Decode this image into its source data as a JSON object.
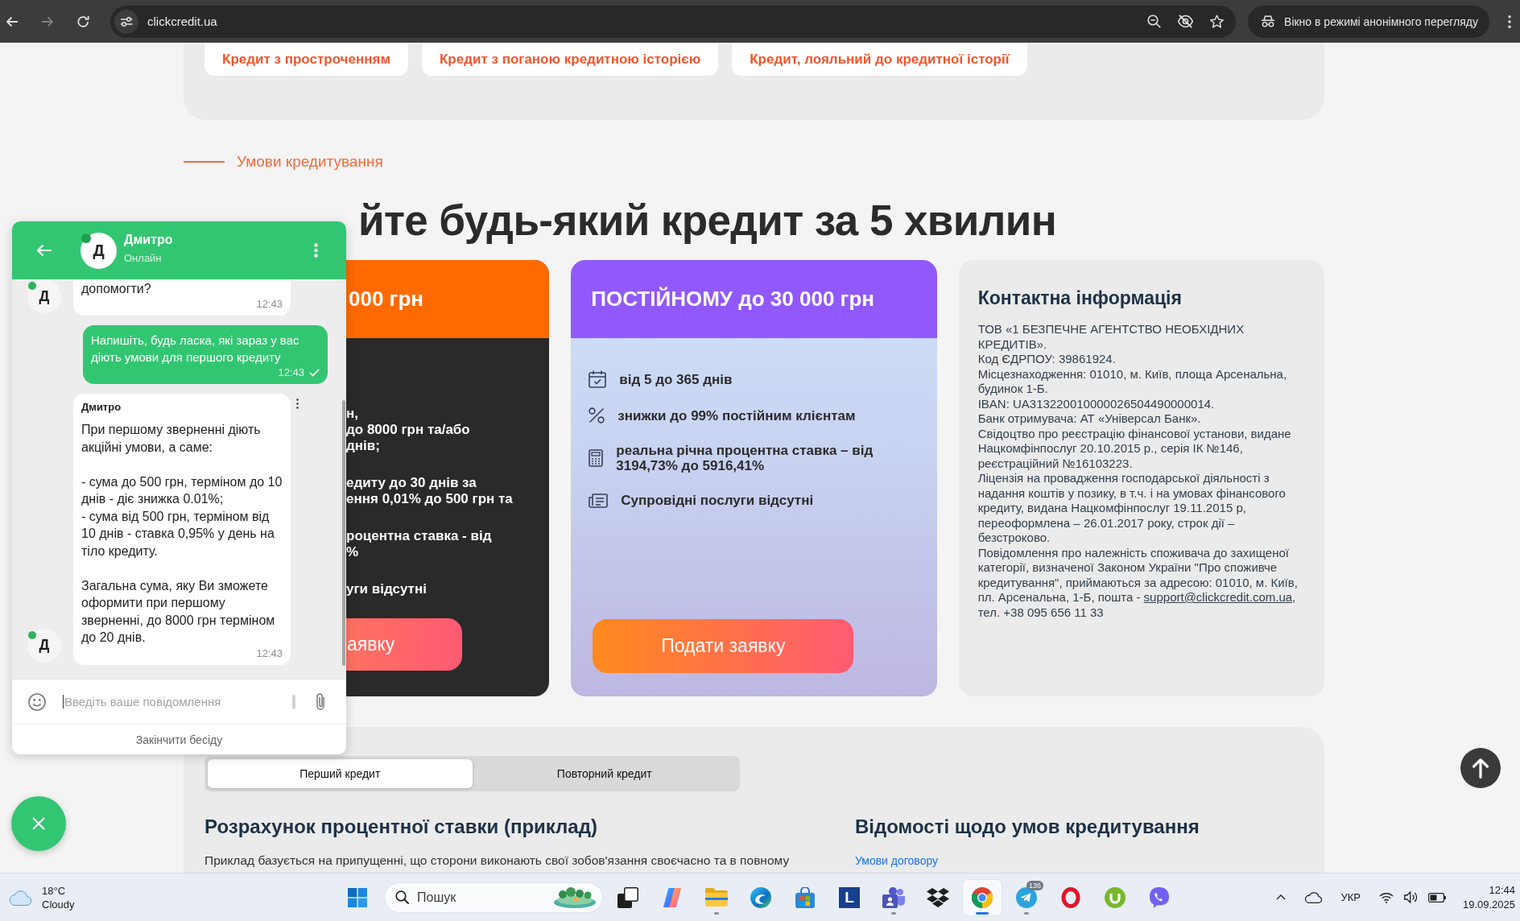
{
  "browser": {
    "url": "clickcredit.ua",
    "incognito_label": "Вікно в режимі анонімного перегляду",
    "back_disabled": false,
    "forward_disabled": true
  },
  "top_links": [
    "Кредит з простроченням",
    "Кредит з поганою кредитною історією",
    "Кредит, лояльний до кредитної історії"
  ],
  "section_label": "Умови кредитування",
  "heading": "йте будь-який кредит за 5 хвилин",
  "offers": [
    {
      "kind": "newcomer",
      "title": "000 грн",
      "items": [
        {
          "lines": [
            "н,",
            "до 8000 грн та/або",
            "днів;"
          ]
        },
        {
          "lines": [
            "едиту до 30 днів за",
            "ення 0,01% до 500 грн та"
          ]
        },
        {
          "lines": [
            "роцентна ставка - від",
            "%"
          ]
        },
        {
          "lines": [
            "уги відсутні"
          ]
        }
      ],
      "button": "аявку"
    },
    {
      "kind": "regular",
      "title": "ПОСТІЙНОМУ до 30 000 грн",
      "items": [
        {
          "kind": "term",
          "text": "від 5 до 365 днів"
        },
        {
          "kind": "discount",
          "text": "знижки до 99% постійним клієнтам"
        },
        {
          "kind": "rate",
          "text": "реальна річна процентна ставка – від 3194,73% до 5916,41%"
        },
        {
          "kind": "services",
          "text": "Супровідні послуги відсутні"
        }
      ],
      "button": "Подати заявку"
    }
  ],
  "contact": {
    "title": "Контактна інформація",
    "paragraphs": [
      "ТОВ «1 БЕЗПЕЧНЕ АГЕНТСТВО НЕОБХІДНИХ КРЕДИТІВ».",
      "Код ЄДРПОУ: 39861924.",
      "Місцезнаходження: 01010, м. Київ, площа Арсенальна, будинок 1-Б.",
      "IBAN: UA313220010000026504490000014.",
      "Банк отримувача: АТ «Універсал Банк».",
      "Свідоцтво про реєстрацію фінансової установи, видане Нацкомфінпослуг 20.10.2015 р., серія ІК №146, реєстраційний №16103223.",
      "Ліцензія на провадження господарської діяльності з надання коштів у позику, в т.ч. і на умовах фінансового кредиту, видана Нацкомфінпослуг 19.11.2015 р, переоформлена – 26.01.2017 року, строк дії – безстроково."
    ],
    "notice": {
      "text": "Повідомлення про належність споживача до захищеної категорії, визначеної Законом України \"Про споживче кредитування\", приймаються за адресою: 01010, м. Київ, пл. Арсенальна, 1-Б, пошта -",
      "email": "support@clickcredit.com.ua",
      "after": ", тел. +38 095 656 11 33"
    }
  },
  "calc": {
    "tabs": [
      {
        "label": "Перший кредит",
        "selected": true
      },
      {
        "label": "Повторний кредит",
        "selected": false
      }
    ],
    "example_title": "Розрахунок процентної ставки (приклад)",
    "example_text": "Приклад базується на припущенні, що сторони виконають свої зобов'язання своєчасно та в повному",
    "terms_title": "Відомості щодо умов кредитування",
    "terms_link": "Умови договору"
  },
  "chat": {
    "agent_name": "Дмитро",
    "agent_initial": "Д",
    "status": "Онлайн",
    "online": true,
    "messages": [
      {
        "kind": "agent",
        "avatar": "Д",
        "text": "допомогти?",
        "time": "12:43"
      },
      {
        "kind": "user",
        "text": "Напишіть, будь ласка, які зараз у вас діють умови для першого кредиту",
        "time": "12:43",
        "read": true
      },
      {
        "kind": "agent",
        "avatar": "Д",
        "sender": "Дмитро",
        "text": "При першому зверненні діють акційні умови, а саме:\n\n- сума до 500 грн, терміном до 10 днів - діє знижка 0.01%;\n- сума від 500 грн, терміном від 10 днів - ставка 0,95% у день на тіло кредиту.\n\nЗагальна сума, яку Ви зможете оформити при першому зверненні, до 8000 грн терміном до 20 днів.",
        "time": "12:43",
        "show_menu": true
      }
    ],
    "input": {
      "placeholder": "Введіть ваше повідомлення"
    },
    "end_label": "Закінчити бесіду"
  },
  "taskbar": {
    "weather": {
      "temp": "18°C",
      "condition": "Cloudy"
    },
    "search": {
      "placeholder": "Пошук"
    },
    "apps": [
      {
        "kind": "squares",
        "selected": false,
        "running": false
      },
      {
        "kind": "ribbons",
        "selected": false,
        "running": false
      },
      {
        "kind": "folder",
        "selected": false,
        "running": true
      },
      {
        "kind": "wave",
        "selected": false,
        "running": false
      },
      {
        "kind": "bag",
        "selected": false,
        "running": false
      },
      {
        "kind": "letter",
        "label": "L",
        "selected": false,
        "running": false
      },
      {
        "kind": "people",
        "selected": false,
        "running": true
      },
      {
        "kind": "diamonds",
        "selected": false,
        "running": false
      },
      {
        "kind": "segments",
        "selected": true,
        "running": true
      },
      {
        "kind": "plane",
        "badge": "136",
        "selected": false,
        "running": true
      },
      {
        "kind": "ring",
        "selected": false,
        "running": false
      },
      {
        "kind": "arc",
        "selected": false,
        "running": false
      },
      {
        "kind": "phone",
        "selected": false,
        "running": false
      }
    ],
    "language": "УКР",
    "time": "12:44",
    "date": "19.09.2025"
  }
}
